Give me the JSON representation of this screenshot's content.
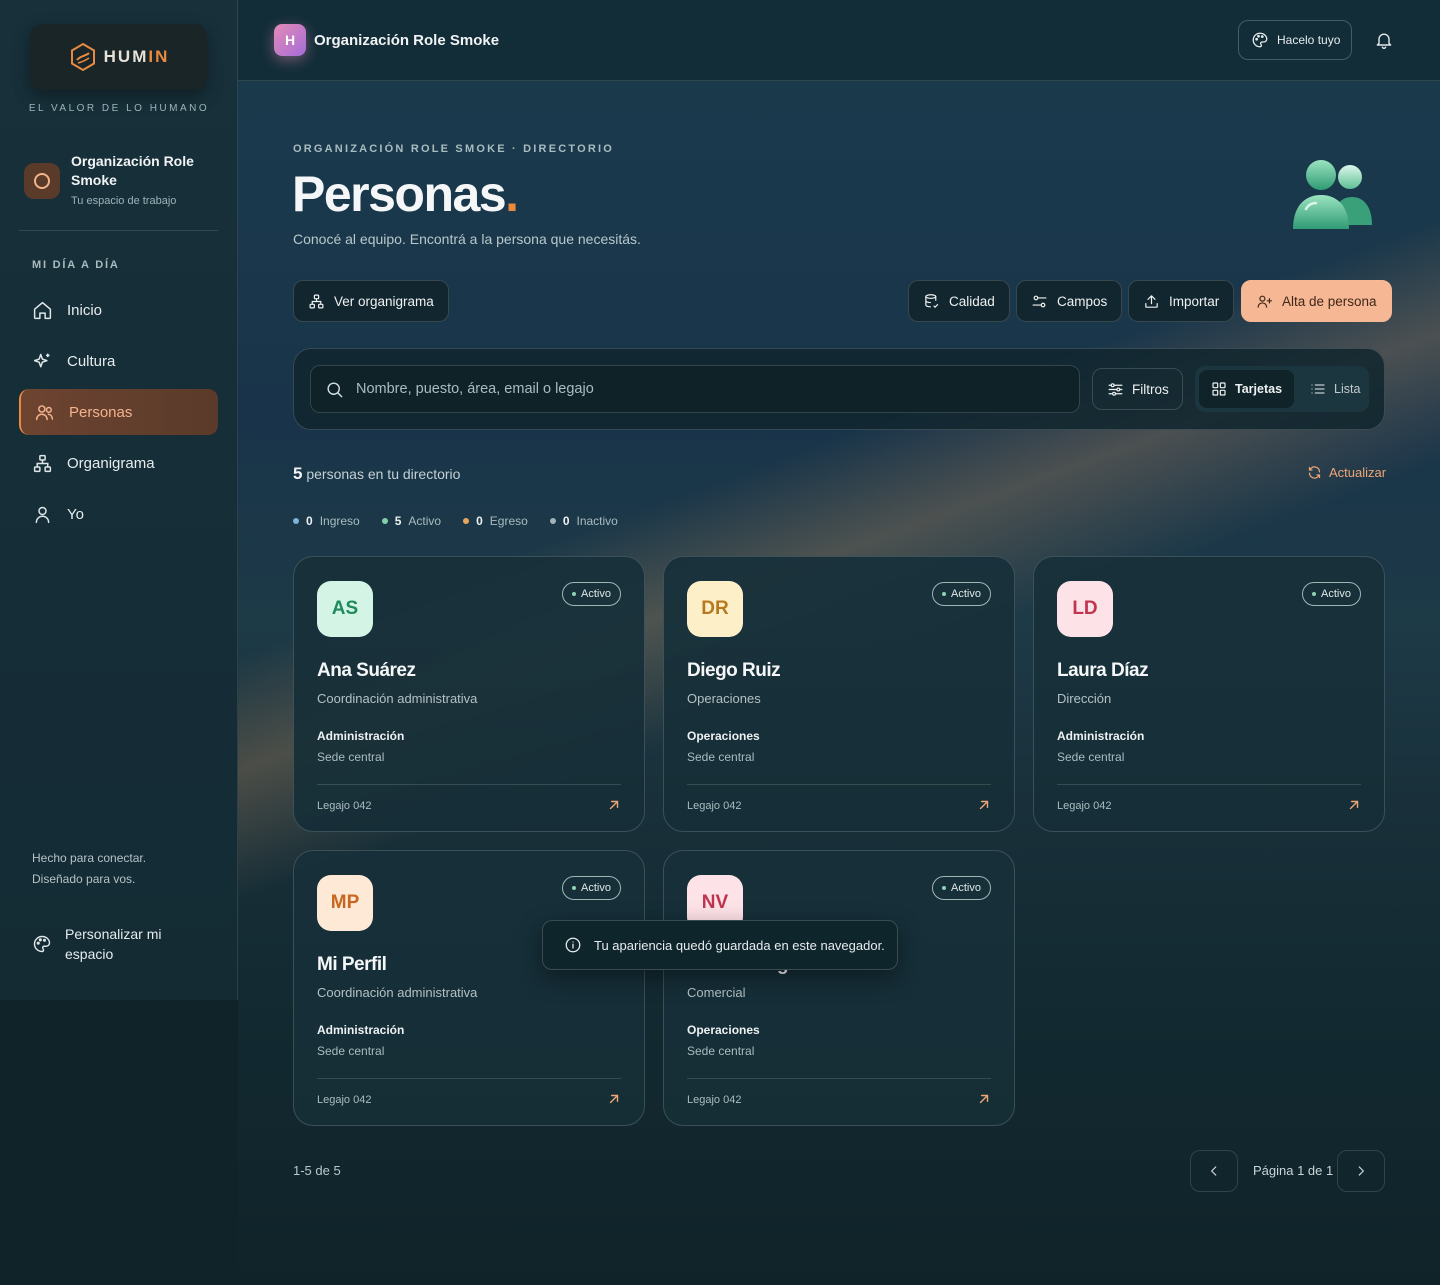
{
  "brand": {
    "logo_text_main": "HUM",
    "logo_text_accent": "IN",
    "tagline": "EL VALOR DE LO HUMANO",
    "accent_color": "#e98a3f"
  },
  "sidebar": {
    "org": {
      "name": "Organización Role Smoke",
      "subtitle": "Tu espacio de trabajo"
    },
    "section_label": "MI DÍA A DÍA",
    "items": [
      {
        "label": "Inicio",
        "icon": "home-icon",
        "active": false
      },
      {
        "label": "Cultura",
        "icon": "sparkle-icon",
        "active": false
      },
      {
        "label": "Personas",
        "icon": "users-icon",
        "active": true
      },
      {
        "label": "Organigrama",
        "icon": "org-chart-icon",
        "active": false
      },
      {
        "label": "Yo",
        "icon": "user-icon",
        "active": false
      }
    ],
    "footer_line1": "Hecho para conectar.",
    "footer_line2": "Diseñado para vos.",
    "personalize_label": "Personalizar mi espacio"
  },
  "topbar": {
    "workspace_initial": "H",
    "workspace_name": "Organización Role Smoke",
    "make_yours_label": "Hacelo tuyo"
  },
  "main": {
    "breadcrumb": "ORGANIZACIÓN ROLE SMOKE · DIRECTORIO",
    "title": "Personas",
    "title_dot": ".",
    "subtitle": "Conocé al equipo. Encontrá a la persona que necesitás.",
    "actions": {
      "org_chart": "Ver organigrama",
      "quality": "Calidad",
      "fields": "Campos",
      "import": "Importar",
      "add_person": "Alta de persona"
    },
    "search": {
      "placeholder": "Nombre, puesto, área, email o legajo",
      "value": "",
      "filters_label": "Filtros",
      "view_cards": "Tarjetas",
      "view_list": "Lista"
    },
    "count_number": "5",
    "count_text": "personas en tu directorio",
    "refresh_label": "Actualizar",
    "status_legend": [
      {
        "count": "0",
        "label": "Ingreso",
        "color": "#7fb4d9"
      },
      {
        "count": "5",
        "label": "Activo",
        "color": "#7fd1a8"
      },
      {
        "count": "0",
        "label": "Egreso",
        "color": "#e9a65a"
      },
      {
        "count": "0",
        "label": "Inactivo",
        "color": "#9fb3b8"
      }
    ],
    "people": [
      {
        "initials": "AS",
        "name": "Ana Suárez",
        "role": "Coordinación administrativa",
        "area": "Administración",
        "site": "Sede central",
        "legajo": "Legajo 042",
        "status": "Activo",
        "avatar_bg": "#d4f5e6",
        "avatar_fg": "#1f8a5b"
      },
      {
        "initials": "DR",
        "name": "Diego Ruiz",
        "role": "Operaciones",
        "area": "Operaciones",
        "site": "Sede central",
        "legajo": "Legajo 042",
        "status": "Activo",
        "avatar_bg": "#fdf0c9",
        "avatar_fg": "#b7791f"
      },
      {
        "initials": "LD",
        "name": "Laura Díaz",
        "role": "Dirección",
        "area": "Administración",
        "site": "Sede central",
        "legajo": "Legajo 042",
        "status": "Activo",
        "avatar_bg": "#fde2e7",
        "avatar_fg": "#c0344f"
      },
      {
        "initials": "MP",
        "name": "Mi Perfil",
        "role": "Coordinación administrativa",
        "area": "Administración",
        "site": "Sede central",
        "legajo": "Legajo 042",
        "status": "Activo",
        "avatar_bg": "#fde9d6",
        "avatar_fg": "#c8671f"
      },
      {
        "initials": "NV",
        "name": "Nicolás Vega",
        "role": "Comercial",
        "area": "Operaciones",
        "site": "Sede central",
        "legajo": "Legajo 042",
        "status": "Activo",
        "avatar_bg": "#fde2e7",
        "avatar_fg": "#c0344f"
      }
    ],
    "toast": "Tu apariencia quedó guardada en este navegador.",
    "pager": {
      "range": "1-5 de 5",
      "label": "Página 1 de 1"
    }
  }
}
